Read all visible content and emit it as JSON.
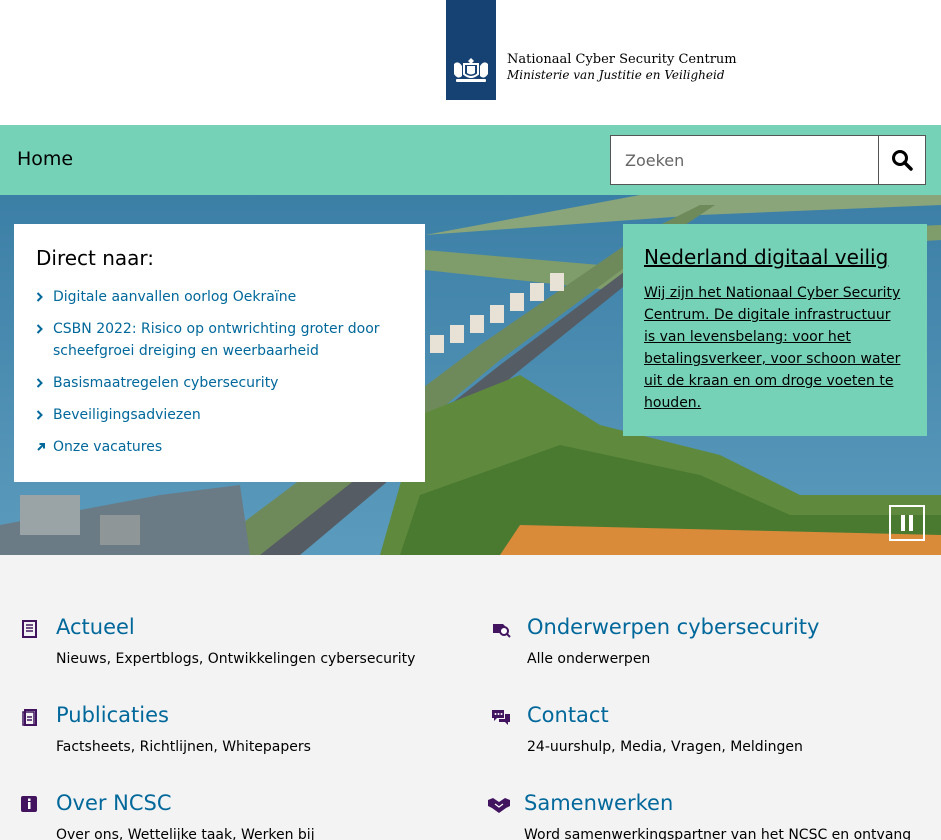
{
  "header": {
    "logo_title": "Nationaal Cyber Security Centrum",
    "logo_subtitle": "Ministerie van Justitie en Veiligheid"
  },
  "nav": {
    "home_label": "Home",
    "search_placeholder": "Zoeken",
    "search_icon": "search-icon"
  },
  "direct": {
    "title": "Direct naar:",
    "items": [
      {
        "label": "Digitale aanvallen oorlog Oekraïne",
        "icon": "chevron-right-icon"
      },
      {
        "label": "CSBN 2022: Risico op ontwrichting groter door scheefgroei dreiging en weerbaarheid",
        "icon": "chevron-right-icon"
      },
      {
        "label": "Basismaatregelen cybersecurity",
        "icon": "chevron-right-icon"
      },
      {
        "label": "Beveiligingsadviezen",
        "icon": "chevron-right-icon"
      },
      {
        "label": "Onze vacatures",
        "icon": "external-arrow-icon"
      }
    ]
  },
  "promo": {
    "title": "Nederland digitaal veilig",
    "text": "Wij zijn het Nationaal Cyber Security Centrum. De digitale infrastructuur is van levensbelang: voor het betalingsverkeer, voor schoon water uit de kraan en om droge voeten te houden."
  },
  "tiles": [
    {
      "title": "Actueel",
      "desc": "Nieuws, Expertblogs, Ontwikkelingen cybersecurity",
      "icon": "newspaper-icon"
    },
    {
      "title": "Onderwerpen cybersecurity",
      "desc": "Alle onderwerpen",
      "icon": "topics-icon"
    },
    {
      "title": "Publicaties",
      "desc": "Factsheets, Richtlijnen, Whitepapers",
      "icon": "document-icon"
    },
    {
      "title": "Contact",
      "desc": "24-uurshulp, Media, Vragen, Meldingen",
      "icon": "chat-icon"
    },
    {
      "title": "Over NCSC",
      "desc": "Over ons, Wettelijke taak, Werken bij",
      "icon": "info-icon"
    },
    {
      "title": "Samenwerken",
      "desc": "Word samenwerkingspartner van het NCSC en ontvang",
      "icon": "handshake-icon"
    }
  ],
  "colors": {
    "brand_blue": "#154273",
    "mint": "#76d2b6",
    "link_blue": "#01689b",
    "icon_purple": "#42145f"
  }
}
